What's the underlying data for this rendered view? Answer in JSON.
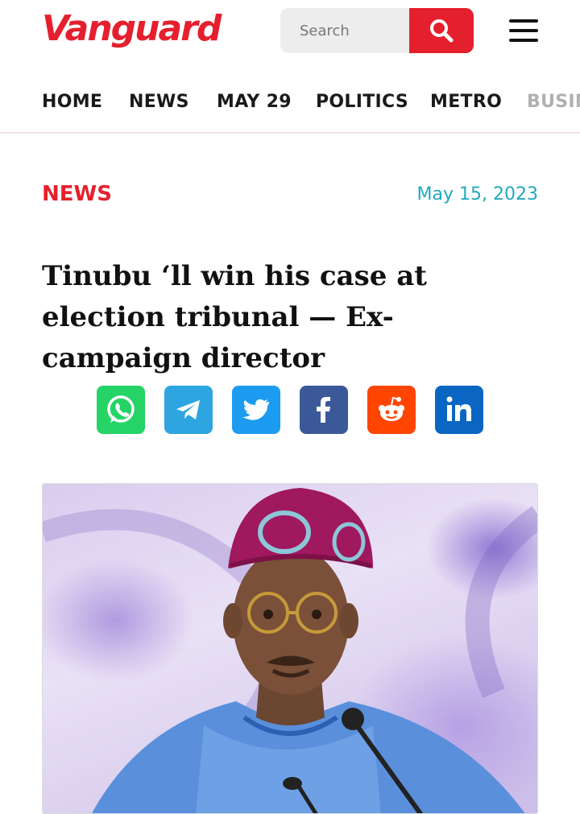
{
  "header": {
    "logo_text": "Vanguard",
    "search_placeholder": "Search"
  },
  "nav": {
    "items": [
      {
        "label": "HOME"
      },
      {
        "label": "NEWS"
      },
      {
        "label": "MAY 29"
      },
      {
        "label": "POLITICS"
      },
      {
        "label": "METRO"
      },
      {
        "label": "BUSIN"
      }
    ]
  },
  "article": {
    "category": "NEWS",
    "date": "May 15, 2023",
    "headline": "Tinubu ‘ll win his case at election tribunal — Ex- campaign director"
  },
  "share": [
    {
      "icon": "whatsapp-icon"
    },
    {
      "icon": "telegram-icon"
    },
    {
      "icon": "twitter-icon"
    },
    {
      "icon": "facebook-icon"
    },
    {
      "icon": "reddit-icon"
    },
    {
      "icon": "linkedin-icon"
    }
  ],
  "colors": {
    "brand_red": "#e5202e",
    "date_teal": "#22a8bd",
    "whatsapp": "#25d366",
    "telegram": "#2ca5e0",
    "twitter": "#1d9bf0",
    "facebook": "#3b5998",
    "reddit": "#ff4500",
    "linkedin": "#0a66c2"
  }
}
